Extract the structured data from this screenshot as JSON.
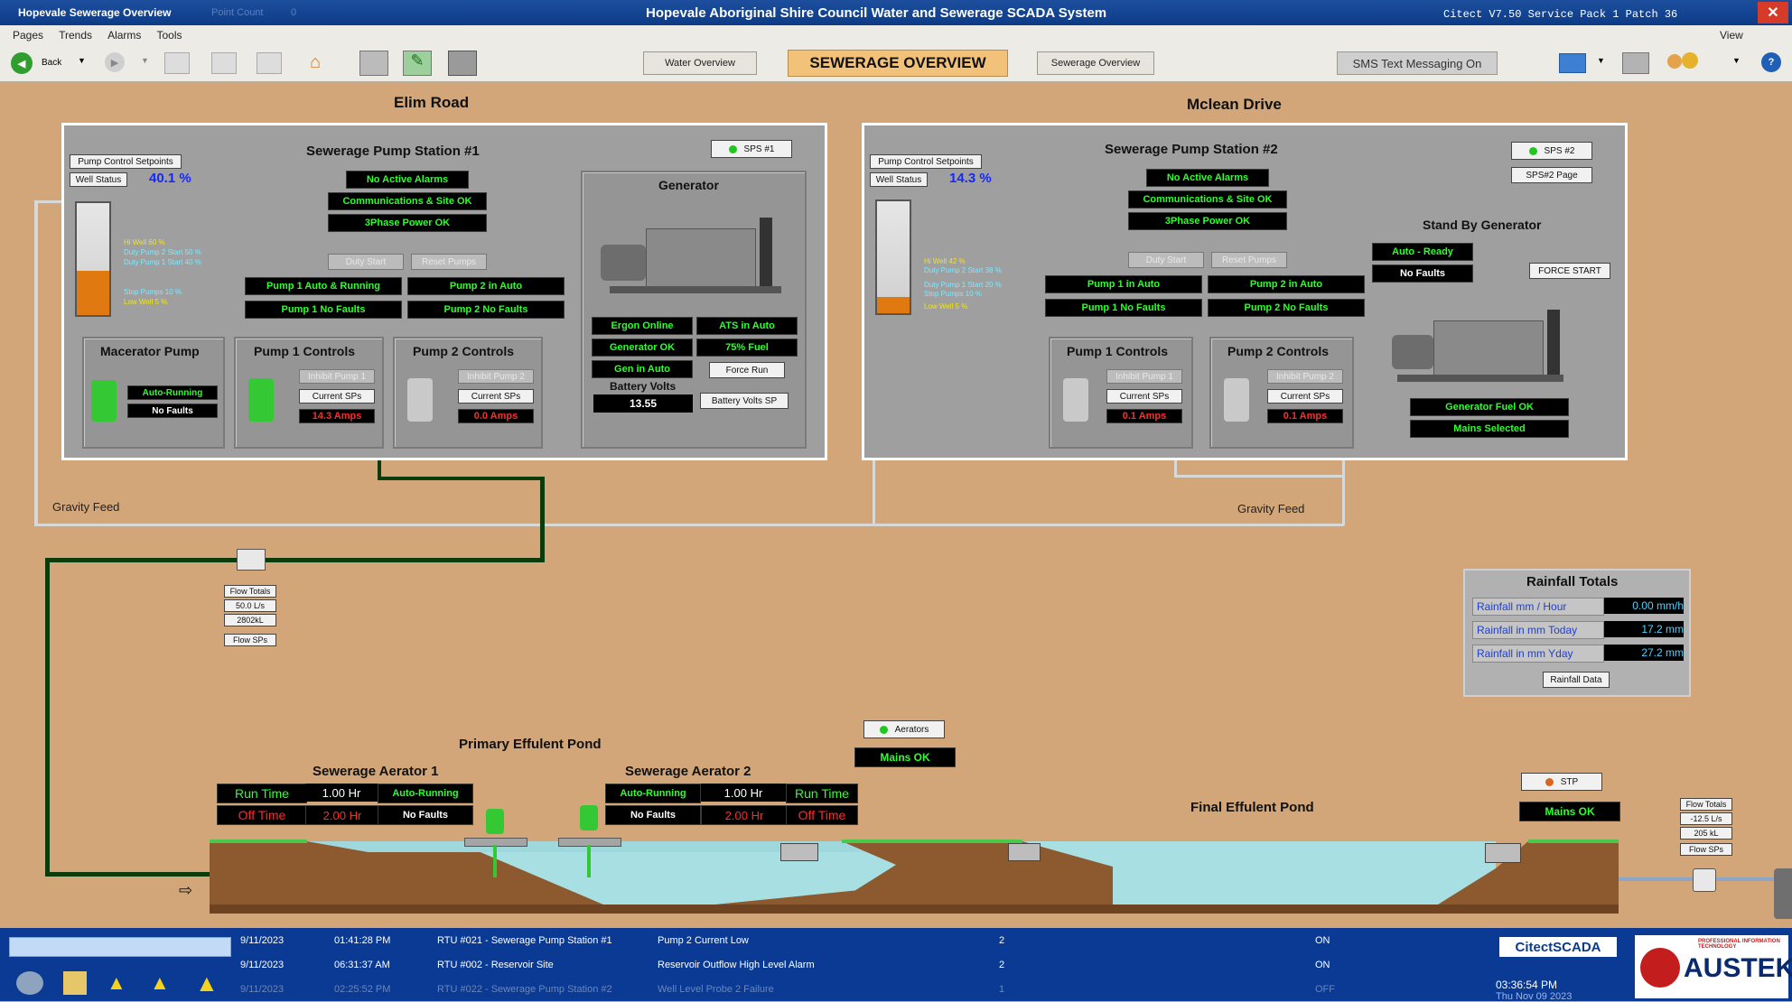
{
  "titlebar": {
    "app": "Hopevale Sewerage Overview",
    "point_count_label": "Point Count",
    "point_count": "0",
    "title": "Hopevale Aboriginal Shire Council Water and Sewerage SCADA System",
    "version": "Citect V7.50 Service Pack 1 Patch 36"
  },
  "menu": {
    "items": [
      "Pages",
      "Trends",
      "Alarms",
      "Tools"
    ],
    "view": "View"
  },
  "toolbar": {
    "back": "Back",
    "water_overview": "Water Overview",
    "page_title": "SEWERAGE OVERVIEW",
    "sewerage_overview": "Sewerage Overview",
    "sms": "SMS Text Messaging On"
  },
  "elim": {
    "site": "Elim Road",
    "station_title": "Sewerage Pump Station #1",
    "sps_badge": "SPS #1",
    "setpoints_btn": "Pump Control Setpoints",
    "well_status_btn": "Well Status",
    "well_level": "40.1 %",
    "levels": [
      "Hi Well 60 %",
      "Duty Pump 2 Start 50 %",
      "Duty Pump 1 Start 40 %",
      "Stop Pumps 10 %",
      "Low Well 5 %"
    ],
    "status": [
      "No Active Alarms",
      "Communications & Site OK",
      "3Phase Power OK"
    ],
    "duty_start": "Duty Start",
    "reset_pumps": "Reset Pumps",
    "pump_status": [
      "Pump 1 Auto & Running",
      "Pump 2 in Auto",
      "Pump 1 No Faults",
      "Pump 2 No Faults"
    ],
    "macerator": {
      "title": "Macerator Pump",
      "state": "Auto-Running",
      "faults": "No Faults"
    },
    "pump1": {
      "title": "Pump 1 Controls",
      "inhibit": "Inhibit Pump 1",
      "current_sps": "Current SPs",
      "amps": "14.3 Amps"
    },
    "pump2": {
      "title": "Pump 2 Controls",
      "inhibit": "Inhibit Pump 2",
      "current_sps": "Current SPs",
      "amps": "0.0 Amps"
    },
    "generator": {
      "title": "Generator",
      "ergon": "Ergon Online",
      "ats": "ATS in Auto",
      "gen_ok": "Generator OK",
      "fuel": "75% Fuel",
      "gen_auto": "Gen in Auto",
      "force_run": "Force Run",
      "batt_label": "Battery Volts",
      "batt_value": "13.55",
      "batt_sp": "Battery Volts SP"
    },
    "gravity": "Gravity Feed"
  },
  "mclean": {
    "site": "Mclean Drive",
    "station_title": "Sewerage Pump Station #2",
    "sps_badge": "SPS #2",
    "page_btn": "SPS#2 Page",
    "setpoints_btn": "Pump Control Setpoints",
    "well_status_btn": "Well Status",
    "well_level": "14.3 %",
    "levels": [
      "Hi Well 42 %",
      "Duty Pump 2 Start 38 %",
      "Stop Pumps 10 %",
      "Duty Pump 1 Start 20 %",
      "Low Well 5 %"
    ],
    "status": [
      "No Active Alarms",
      "Communications & Site OK",
      "3Phase Power OK"
    ],
    "duty_start": "Duty Start",
    "reset_pumps": "Reset Pumps",
    "pump_status": [
      "Pump 1 in Auto",
      "Pump 2 in Auto",
      "Pump 1 No Faults",
      "Pump 2 No Faults"
    ],
    "pump1": {
      "title": "Pump 1 Controls",
      "inhibit": "Inhibit Pump 1",
      "current_sps": "Current SPs",
      "amps": "0.1 Amps"
    },
    "pump2": {
      "title": "Pump 2 Controls",
      "inhibit": "Inhibit Pump 2",
      "current_sps": "Current SPs",
      "amps": "0.1 Amps"
    },
    "standby": {
      "title": "Stand By Generator",
      "auto": "Auto - Ready",
      "faults": "No Faults",
      "force_start": "FORCE START",
      "fuel": "Generator Fuel OK",
      "mains": "Mains Selected"
    },
    "gravity": "Gravity Feed"
  },
  "flow1": {
    "title": "Flow Totals",
    "rate": "50.0 L/s",
    "total": "2802kL",
    "sps": "Flow SPs"
  },
  "flow2": {
    "title": "Flow Totals",
    "rate": "-12.5 L/s",
    "total": "205 kL",
    "sps": "Flow SPs"
  },
  "rainfall": {
    "title": "Rainfall Totals",
    "rows": [
      {
        "label": "Rainfall mm / Hour",
        "value": "0.00 mm/h"
      },
      {
        "label": "Rainfall in mm Today",
        "value": "17.2 mm"
      },
      {
        "label": "Rainfall in mm Yday",
        "value": "27.2 mm"
      }
    ],
    "data_btn": "Rainfall Data"
  },
  "aerators": {
    "badge": "Aerators",
    "mains": "Mains OK",
    "pond1": "Primary Effulent Pond",
    "a1": {
      "title": "Sewerage Aerator 1",
      "run_label": "Run Time",
      "run": "1.00 Hr",
      "state": "Auto-Running",
      "off_label": "Off Time",
      "off": "2.00 Hr",
      "faults": "No Faults"
    },
    "a2": {
      "title": "Sewerage Aerator 2",
      "run_label": "Run Time",
      "run": "1.00 Hr",
      "state": "Auto-Running",
      "off_label": "Off Time",
      "off": "2.00 Hr",
      "faults": "No Faults"
    }
  },
  "stp": {
    "badge": "STP",
    "mains": "Mains OK",
    "pond2": "Final Effulent Pond"
  },
  "alarms": [
    {
      "date": "9/11/2023",
      "time": "01:41:28 PM",
      "source": "RTU #021 - Sewerage Pump Station #1",
      "desc": "Pump 2 Current Low",
      "priority": "2",
      "state": "ON"
    },
    {
      "date": "9/11/2023",
      "time": "06:31:37 AM",
      "source": "RTU #002 - Reservoir Site",
      "desc": "Reservoir Outflow High Level Alarm",
      "priority": "2",
      "state": "ON"
    },
    {
      "date": "9/11/2023",
      "time": "02:25:52 PM",
      "source": "RTU #022 - Sewerage Pump Station #2",
      "desc": "Well Level Probe 2 Failure",
      "priority": "1",
      "state": "OFF"
    }
  ],
  "footer": {
    "brand": "CitectSCADA",
    "time": "03:36:54 PM",
    "date": "Thu Nov 09 2023",
    "logo": "AUSTEK",
    "logo_sub": "PROFESSIONAL INFORMATION TECHNOLOGY"
  },
  "colors": {
    "background": "#d2a679",
    "panel": "#9f9f9f",
    "ok_text": "#2cff2c",
    "alarm_text": "#ff2a2a",
    "pipe": "#0b3a0b",
    "water": "#9fd8dc"
  }
}
